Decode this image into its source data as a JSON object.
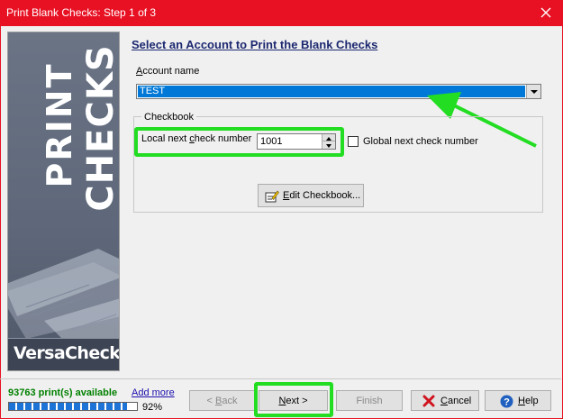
{
  "window": {
    "title": "Print Blank Checks: Step 1 of 3",
    "close_icon": "close-icon"
  },
  "sidebar": {
    "brand_line1": "PRINT",
    "brand_line2": "CHECKS",
    "logo": "VersaCheck"
  },
  "main": {
    "heading": "Select an Account to Print the Blank Checks",
    "account_label": "Account name",
    "account_value": "TEST",
    "checkbook_group": "Checkbook",
    "local_next_check_label": "Local next check number",
    "local_next_check_value": "1001",
    "global_next_check_label": "Global next check number",
    "global_checked": false,
    "edit_checkbook_label": "Edit Checkbook..."
  },
  "status": {
    "prints_available": "93763 print(s) available",
    "add_more": "Add more",
    "progress_percent": 92,
    "progress_text": "92%"
  },
  "buttons": {
    "back": "< Back",
    "next": "Next >",
    "finish": "Finish",
    "cancel": "Cancel",
    "help": "Help"
  },
  "colors": {
    "titlebar": "#e81123",
    "highlight": "#22dd22",
    "selection": "#0078d7"
  }
}
